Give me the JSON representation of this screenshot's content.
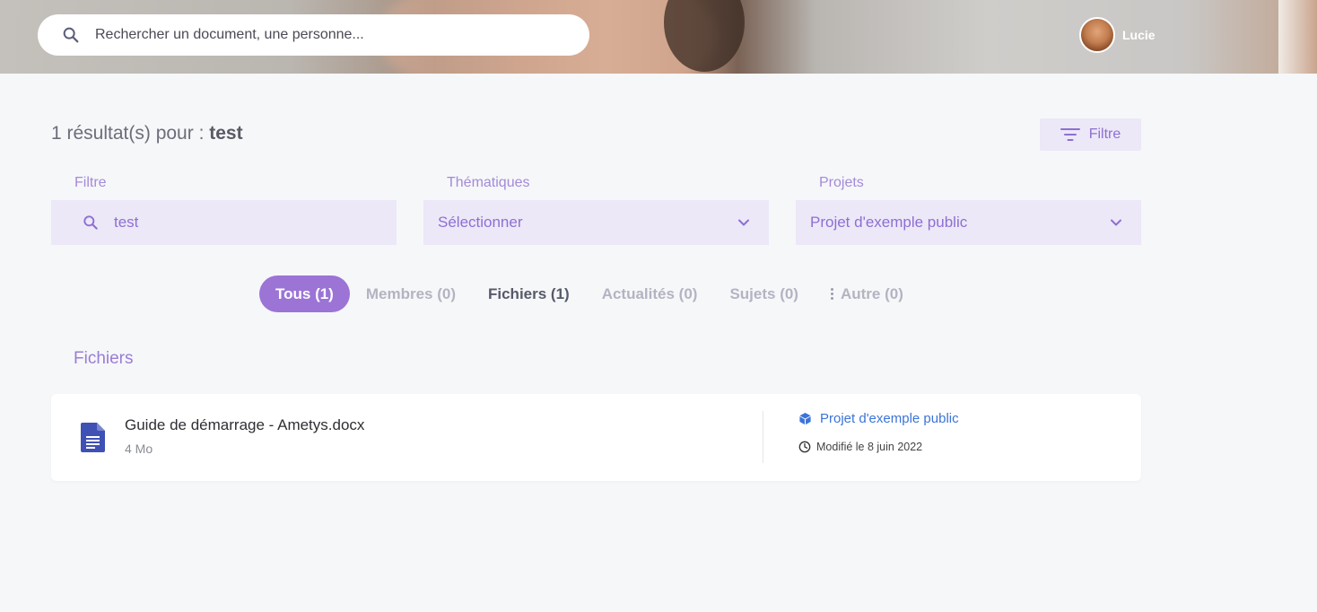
{
  "header": {
    "search_placeholder": "Rechercher un document, une personne...",
    "user_name": "Lucie"
  },
  "results": {
    "prefix": "1 résultat(s) pour : ",
    "query": "test",
    "filter_button": "Filtre"
  },
  "filters": {
    "filtre": {
      "label": "Filtre",
      "value": "test"
    },
    "thematiques": {
      "label": "Thématiques",
      "value": "Sélectionner"
    },
    "projets": {
      "label": "Projets",
      "value": "Projet d'exemple public"
    }
  },
  "tabs": [
    {
      "label": "Tous (1)"
    },
    {
      "label": "Membres (0)"
    },
    {
      "label": "Fichiers (1)"
    },
    {
      "label": "Actualités (0)"
    },
    {
      "label": "Sujets (0)"
    },
    {
      "label": "Autre (0)"
    }
  ],
  "section": {
    "title": "Fichiers"
  },
  "file": {
    "name": "Guide de démarrage - Ametys.docx",
    "size": "4 Mo",
    "project": "Projet d'exemple public",
    "modified": "Modifié le 8 juin 2022"
  },
  "colors": {
    "accent": "#9b74d6",
    "field_bg": "#ece8f8",
    "link": "#3b74d9"
  }
}
